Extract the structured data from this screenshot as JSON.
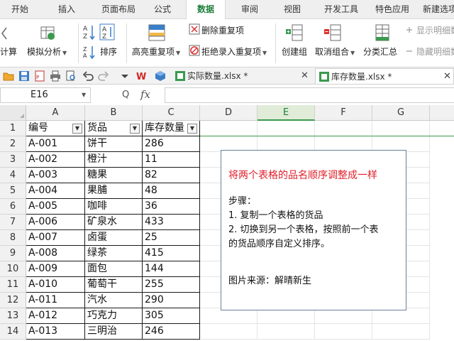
{
  "menu": {
    "tabs": [
      "开始",
      "插入",
      "页面布局",
      "公式",
      "数据",
      "审阅",
      "视图",
      "开发工具",
      "特色应用",
      "新建选项"
    ],
    "active_index": 4
  },
  "ribbon": {
    "calc_label": "计算",
    "simulate_label": "模拟分析",
    "sort_label": "排序",
    "highlight_dup_label": "高亮重复项",
    "remove_dup_label": "删除重复项",
    "reject_dup_label": "拒绝录入重复项",
    "create_group_label": "创建组",
    "ungroup_label": "取消组合",
    "subtotal_label": "分类汇总",
    "show_detail_label": "显示明细数据",
    "hide_detail_label": "隐藏明细数据"
  },
  "files": {
    "tab1": "实际数量.xlsx *",
    "tab2": "库存数量.xlsx *"
  },
  "formula_bar": {
    "cell_ref": "E16",
    "zoom_glyph": "Q",
    "fx_label": "fx"
  },
  "grid": {
    "columns": [
      "A",
      "B",
      "C",
      "D",
      "E",
      "F",
      "G"
    ],
    "selected_column": "E",
    "row_numbers": [
      "1",
      "2",
      "3",
      "4",
      "5",
      "6",
      "7",
      "8",
      "9",
      "10",
      "11",
      "12",
      "13",
      "14"
    ],
    "headers": [
      "编号",
      "货品",
      "库存数量"
    ],
    "rows": [
      [
        "A-001",
        "饼干",
        "286"
      ],
      [
        "A-002",
        "橙汁",
        "11"
      ],
      [
        "A-003",
        "糖果",
        "82"
      ],
      [
        "A-004",
        "果脯",
        "48"
      ],
      [
        "A-005",
        "咖啡",
        "36"
      ],
      [
        "A-006",
        "矿泉水",
        "433"
      ],
      [
        "A-007",
        "卤蛋",
        "25"
      ],
      [
        "A-008",
        "绿茶",
        "415"
      ],
      [
        "A-009",
        "面包",
        "144"
      ],
      [
        "A-010",
        "葡萄干",
        "255"
      ],
      [
        "A-011",
        "汽水",
        "290"
      ],
      [
        "A-012",
        "巧克力",
        "305"
      ],
      [
        "A-013",
        "三明治",
        "246"
      ]
    ]
  },
  "note": {
    "title": "将两个表格的品名顺序调整成一样",
    "steps_label": "步骤：",
    "step1": "1. 复制一个表格的货品",
    "step2a": "2. 切换到另一个表格，按照前一个表",
    "step2b": "的货品顺序自定义排序。",
    "source": "图片来源：解晴新生"
  },
  "colors": {
    "accent_green": "#1f7f3c",
    "note_title_red": "#e0202a",
    "note_border": "#6a7f9c"
  }
}
